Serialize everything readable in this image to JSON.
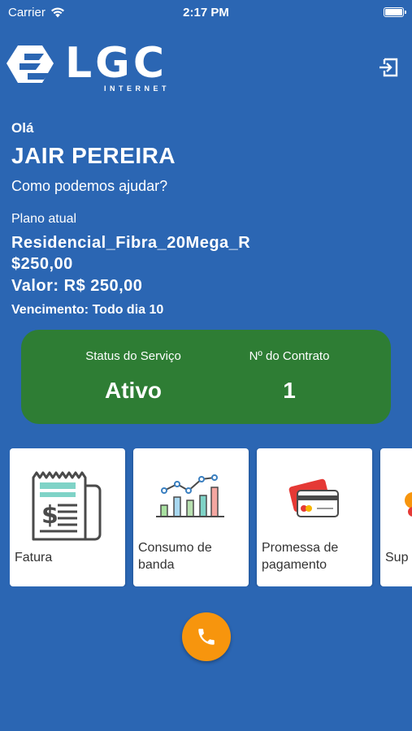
{
  "status_bar": {
    "carrier": "Carrier",
    "time": "2:17 PM"
  },
  "brand": {
    "name": "LGC",
    "tagline": "INTERNET"
  },
  "greeting": "Olá",
  "user_name": "JAIR PEREIRA",
  "help_text": "Como podemos ajudar?",
  "plan": {
    "label": "Plano atual",
    "name": "Residencial_Fibra_20Mega_R$250,00",
    "value": "Valor: R$ 250,00",
    "due": "Vencimento: Todo dia 10"
  },
  "service_card": {
    "status_label": "Status do Serviço",
    "status_value": "Ativo",
    "contract_label": "Nº do Contrato",
    "contract_value": "1",
    "color": "#2e7d34"
  },
  "menu_cards": [
    {
      "label": "Fatura",
      "icon": "invoice-icon"
    },
    {
      "label": "Consumo de banda",
      "icon": "bandwidth-chart-icon"
    },
    {
      "label": "Promessa de pagamento",
      "icon": "credit-card-icon"
    },
    {
      "label": "Sup",
      "icon": "support-icon"
    }
  ],
  "colors": {
    "background": "#2b66b3",
    "fab": "#f7950d"
  },
  "fab": {
    "icon": "phone-icon"
  }
}
